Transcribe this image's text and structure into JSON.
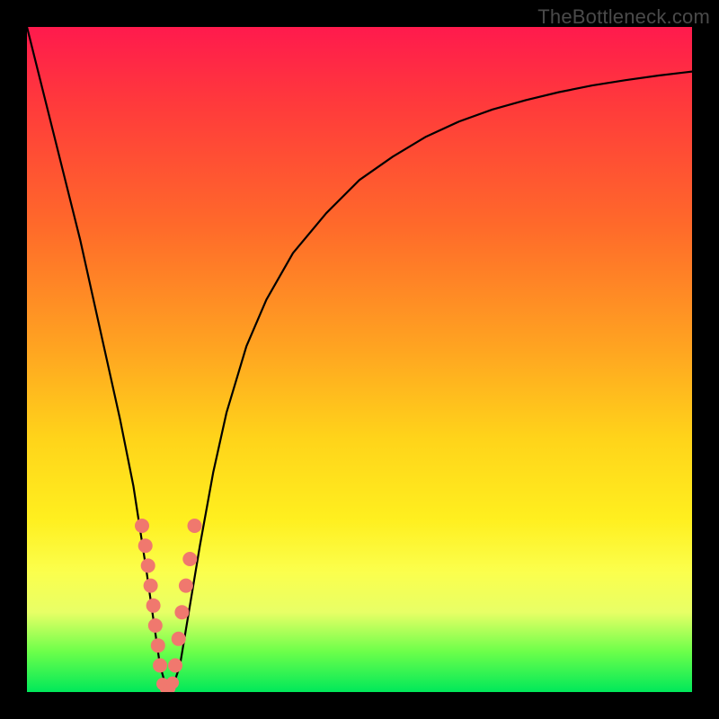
{
  "watermark": {
    "text": "TheBottleneck.com"
  },
  "colors": {
    "curve": "#000000",
    "beads": "#f0786e",
    "frame": "#000000"
  },
  "chart_data": {
    "type": "line",
    "title": "",
    "xlabel": "",
    "ylabel": "",
    "xlim": [
      0,
      100
    ],
    "ylim": [
      0,
      100
    ],
    "grid": false,
    "legend": false,
    "annotations": [],
    "series": [
      {
        "name": "bottleneck-curve",
        "x": [
          0,
          2,
          4,
          6,
          8,
          10,
          12,
          14,
          16,
          18,
          19,
          20,
          21,
          22,
          23,
          24,
          26,
          28,
          30,
          33,
          36,
          40,
          45,
          50,
          55,
          60,
          65,
          70,
          75,
          80,
          85,
          90,
          95,
          100
        ],
        "y": [
          100,
          92,
          84,
          76,
          68,
          59,
          50,
          41,
          31,
          18,
          11,
          4,
          0.5,
          1,
          4,
          10,
          22,
          33,
          42,
          52,
          59,
          66,
          72,
          77,
          80.5,
          83.5,
          85.8,
          87.6,
          89,
          90.2,
          91.2,
          92,
          92.7,
          93.3
        ]
      }
    ],
    "beads": {
      "left": {
        "x": [
          17.3,
          17.8,
          18.2,
          18.6,
          19.0,
          19.3,
          19.7,
          20.0
        ],
        "y": [
          25,
          22,
          19,
          16,
          13,
          10,
          7,
          4
        ]
      },
      "right": {
        "x": [
          22.3,
          22.8,
          23.3,
          23.9,
          24.5,
          25.2
        ],
        "y": [
          4,
          8,
          12,
          16,
          20,
          25
        ]
      },
      "bottom": {
        "x": [
          20.4,
          20.9,
          21.4,
          21.9
        ],
        "y": [
          1.2,
          0.6,
          0.6,
          1.4
        ]
      }
    }
  }
}
